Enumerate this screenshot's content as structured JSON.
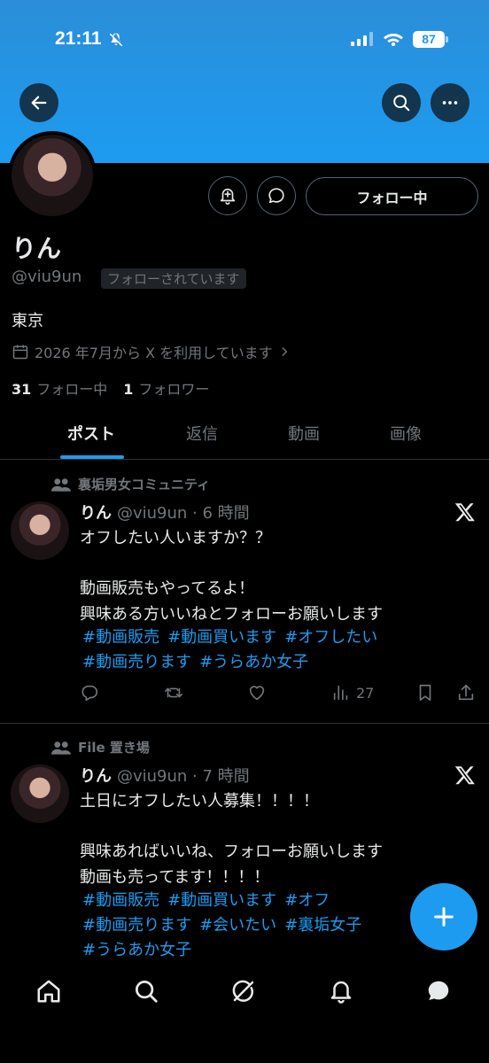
{
  "status_bar": {
    "time": "21:11",
    "battery": "87"
  },
  "profile": {
    "name": "りん",
    "handle": "@viu9un",
    "follows_you_badge": "フォローされています",
    "follow_button": "フォロー中",
    "location": "東京",
    "joined": "2026 年7月から X を利用しています",
    "following_count": "31",
    "following_label": "フォロー中",
    "followers_count": "1",
    "followers_label": "フォロワー"
  },
  "tabs": [
    {
      "label": "ポスト",
      "active": true
    },
    {
      "label": "返信",
      "active": false
    },
    {
      "label": "動画",
      "active": false
    },
    {
      "label": "画像",
      "active": false
    }
  ],
  "posts": [
    {
      "community": "裏垢男女コミュニティ",
      "name": "りん",
      "meta": "@viu9un · 6 時間",
      "text": "オフしたい人いますか？？\n\n動画販売もやってるよ！\n興味ある方いいねとフォローお願いします",
      "hashtag_lines": [
        [
          "#動画販売",
          "#動画買います",
          "#オフしたい"
        ],
        [
          "#動画売ります",
          "#うらあか女子"
        ]
      ],
      "views": "27"
    },
    {
      "community": "File 置き場",
      "name": "りん",
      "meta": "@viu9un · 7 時間",
      "text": "土日にオフしたい人募集！！！！\n\n興味あればいいね、フォローお願いします\n動画も売ってます！！！！",
      "hashtag_lines": [
        [
          "#動画販売",
          "#動画買います",
          "#オフ"
        ],
        [
          "#動画売ります",
          "#会いたい",
          "#裏垢女子"
        ],
        [
          "#うらあか女子"
        ]
      ]
    }
  ],
  "colors": {
    "accent": "#1d9bf0",
    "muted": "#71767b",
    "background": "#000000"
  }
}
